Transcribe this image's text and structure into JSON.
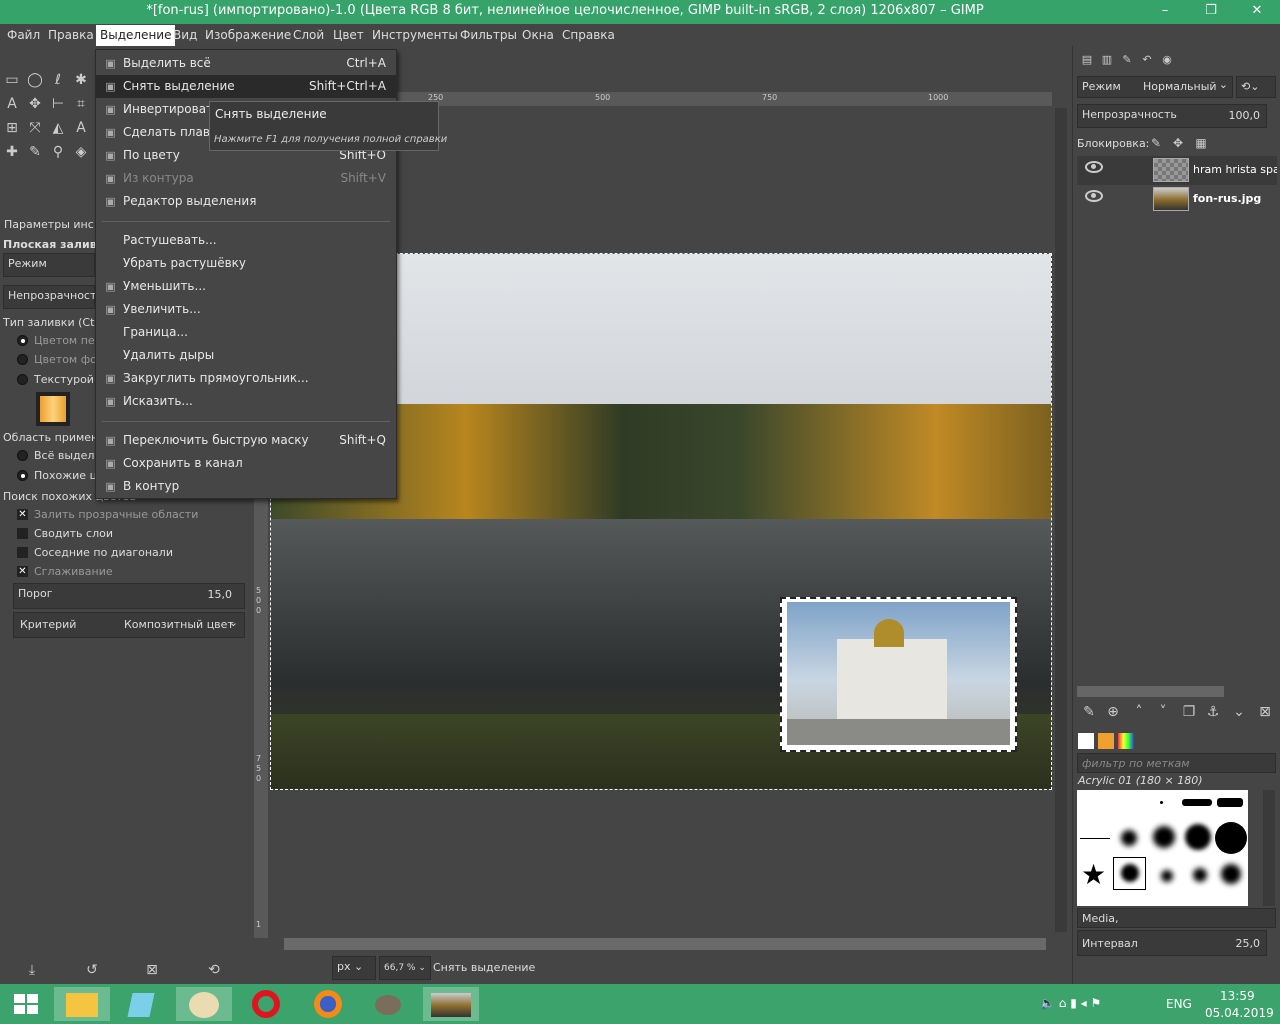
{
  "window": {
    "title": "*[fon-rus] (импортировано)-1.0 (Цвета RGB 8 бит, нелинейное целочисленное, GIMP built-in sRGB, 2 слоя) 1206x807 – GIMP",
    "minimize": "–",
    "restore": "❐",
    "close": "✕"
  },
  "menubar": [
    "Файл",
    "Правка",
    "Выделение",
    "Вид",
    "Изображение",
    "Слой",
    "Цвет",
    "Инструменты",
    "Фильтры",
    "Окна",
    "Справка"
  ],
  "select_menu": {
    "items": [
      {
        "label": "Выделить всё",
        "shortcut": "Ctrl+A",
        "icon": "select-all-icon"
      },
      {
        "label": "Снять выделение",
        "shortcut": "Shift+Ctrl+A",
        "icon": "select-none-icon",
        "highlight": true
      },
      {
        "label": "Инвертировать",
        "shortcut": "",
        "icon": "invert-icon"
      },
      {
        "label": "Сделать плавающим",
        "shortcut": "",
        "icon": "float-icon"
      },
      {
        "label": "По цвету",
        "shortcut": "Shift+O",
        "icon": "by-color-icon"
      },
      {
        "label": "Из контура",
        "shortcut": "Shift+V",
        "icon": "from-path-icon",
        "disabled": true
      },
      {
        "label": "Редактор выделения",
        "shortcut": "",
        "icon": "editor-icon"
      },
      {
        "label": "Растушевать...",
        "shortcut": "",
        "icon": ""
      },
      {
        "label": "Убрать растушёвку",
        "shortcut": "",
        "icon": ""
      },
      {
        "label": "Уменьшить...",
        "shortcut": "",
        "icon": "shrink-icon"
      },
      {
        "label": "Увеличить...",
        "shortcut": "",
        "icon": "grow-icon"
      },
      {
        "label": "Граница...",
        "shortcut": "",
        "icon": ""
      },
      {
        "label": "Удалить дыры",
        "shortcut": "",
        "icon": ""
      },
      {
        "label": "Закруглить прямоугольник...",
        "shortcut": "",
        "icon": "round-icon"
      },
      {
        "label": "Исказить...",
        "shortcut": "",
        "icon": "distort-icon"
      },
      {
        "label": "Переключить быструю маску",
        "shortcut": "Shift+Q",
        "icon": "quickmask-icon"
      },
      {
        "label": "Сохранить в канал",
        "shortcut": "",
        "icon": "channel-icon"
      },
      {
        "label": "В контур",
        "shortcut": "",
        "icon": "to-path-icon"
      }
    ]
  },
  "tooltip": {
    "title": "Снять выделение",
    "hint": "Нажмите F1 для получения полной справки"
  },
  "tool_options": {
    "tab": "Параметры инс",
    "tool_name": "Плоская заливк",
    "mode_label": "Режим",
    "opacity_label": "Непрозрачность",
    "fill_type": "Тип заливки  (Ctrl)",
    "fg": "Цветом пер",
    "bg": "Цветом фон",
    "pattern": "Текстурой",
    "area": "Область примене",
    "whole": "Всё выделе",
    "similar": "Похожие цв",
    "search": "Поиск похожих цветов",
    "fill_transparent": "Залить прозрачные области",
    "sample_merged": "Сводить слои",
    "diagonal": "Соседние по диагонали",
    "antialias": "Сглаживание",
    "threshold_label": "Порог",
    "threshold_value": "15,0",
    "criterion_label": "Критерий",
    "criterion_value": "Композитный цвет"
  },
  "rulers": {
    "h": [
      "250",
      "500",
      "750",
      "1000"
    ],
    "v": [
      "5",
      "0",
      "0",
      "7",
      "5",
      "0",
      "1"
    ]
  },
  "status": {
    "unit": "px",
    "zoom": "66,7 %",
    "message": "Снять выделение"
  },
  "layers": {
    "mode_label": "Режим",
    "mode_value": "Нормальный",
    "opacity_label": "Непрозрачность",
    "opacity_value": "100,0",
    "lock_label": "Блокировка:",
    "items": [
      {
        "name": "hram hrista spasit"
      },
      {
        "name": "fon-rus.jpg"
      }
    ]
  },
  "brushes": {
    "filter_placeholder": "фильтр по меткам",
    "current": "Acrylic 01 (180 × 180)",
    "category": "Media,",
    "spacing_label": "Интервал",
    "spacing_value": "25,0"
  },
  "taskbar": {
    "lang": "ENG",
    "time": "13:59",
    "date": "05.04.2019"
  },
  "colors": {
    "accent": "#35a36a",
    "taskbar": "#3ba36b",
    "bg": "#454545",
    "menu_hl": "#2a2a2a"
  }
}
